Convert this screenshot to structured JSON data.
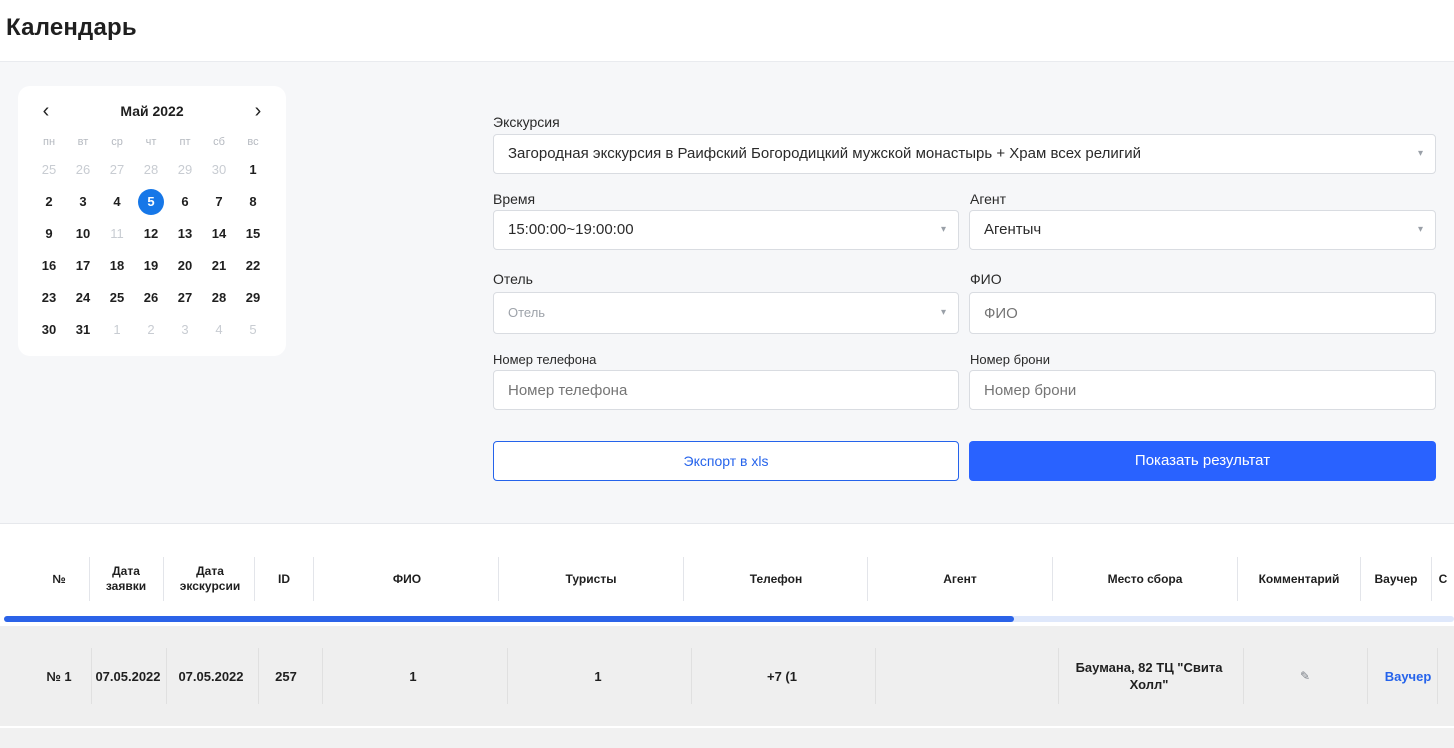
{
  "page": {
    "title": "Календарь"
  },
  "calendar": {
    "prev": "‹",
    "next": "›",
    "month_title": "Май 2022",
    "weekdays": [
      "пн",
      "вт",
      "ср",
      "чт",
      "пт",
      "сб",
      "вс"
    ],
    "weeks": [
      [
        {
          "d": "25",
          "m": true
        },
        {
          "d": "26",
          "m": true
        },
        {
          "d": "27",
          "m": true
        },
        {
          "d": "28",
          "m": true
        },
        {
          "d": "29",
          "m": true
        },
        {
          "d": "30",
          "m": true
        },
        {
          "d": "1"
        }
      ],
      [
        {
          "d": "2"
        },
        {
          "d": "3"
        },
        {
          "d": "4"
        },
        {
          "d": "5",
          "sel": true
        },
        {
          "d": "6"
        },
        {
          "d": "7"
        },
        {
          "d": "8"
        }
      ],
      [
        {
          "d": "9"
        },
        {
          "d": "10"
        },
        {
          "d": "11",
          "m": true
        },
        {
          "d": "12"
        },
        {
          "d": "13"
        },
        {
          "d": "14"
        },
        {
          "d": "15"
        }
      ],
      [
        {
          "d": "16"
        },
        {
          "d": "17"
        },
        {
          "d": "18"
        },
        {
          "d": "19"
        },
        {
          "d": "20"
        },
        {
          "d": "21"
        },
        {
          "d": "22"
        }
      ],
      [
        {
          "d": "23"
        },
        {
          "d": "24"
        },
        {
          "d": "25"
        },
        {
          "d": "26"
        },
        {
          "d": "27"
        },
        {
          "d": "28"
        },
        {
          "d": "29"
        }
      ],
      [
        {
          "d": "30"
        },
        {
          "d": "31"
        },
        {
          "d": "1",
          "m": true
        },
        {
          "d": "2",
          "m": true
        },
        {
          "d": "3",
          "m": true
        },
        {
          "d": "4",
          "m": true
        },
        {
          "d": "5",
          "m": true
        }
      ]
    ]
  },
  "form": {
    "excursion_label": "Экскурсия",
    "excursion_value": "Загородная экскурсия в Раифский Богородицкий мужской монастырь + Храм всех религий",
    "time_label": "Время",
    "time_value": "15:00:00~19:00:00",
    "agent_label": "Агент",
    "agent_value": "Агентыч",
    "hotel_label": "Отель",
    "hotel_placeholder": "Отель",
    "fio_label": "ФИО",
    "fio_placeholder": "ФИО",
    "phone_label": "Номер телефона",
    "phone_placeholder": "Номер телефона",
    "booking_label": "Номер брони",
    "booking_placeholder": "Номер брони",
    "caret": "▾",
    "export_button": "Экспорт в xls",
    "show_button": "Показать результат"
  },
  "table": {
    "headers": {
      "num": "№",
      "request_date": "Дата заявки",
      "excursion_date": "Дата экскурсии",
      "id": "ID",
      "fio": "ФИО",
      "tourists": "Туристы",
      "phone": "Телефон",
      "agent": "Агент",
      "meeting_point": "Место сбора",
      "comment": "Комментарий",
      "voucher": "Ваучер",
      "next_col": "С"
    },
    "rows": [
      {
        "num": "№ 1",
        "request_date": "07.05.2022",
        "excursion_date": "07.05.2022",
        "id": "257",
        "fio": "1",
        "tourists": "1",
        "phone": "+7 (1",
        "agent": "",
        "meeting_point": "Баумана, 82 ТЦ \"Свита Холл\"",
        "comment_icon": "✎",
        "voucher": "Ваучер"
      }
    ]
  },
  "colors": {
    "accent": "#2962ff",
    "selected_day": "#1677e8",
    "link": "#2563eb"
  }
}
